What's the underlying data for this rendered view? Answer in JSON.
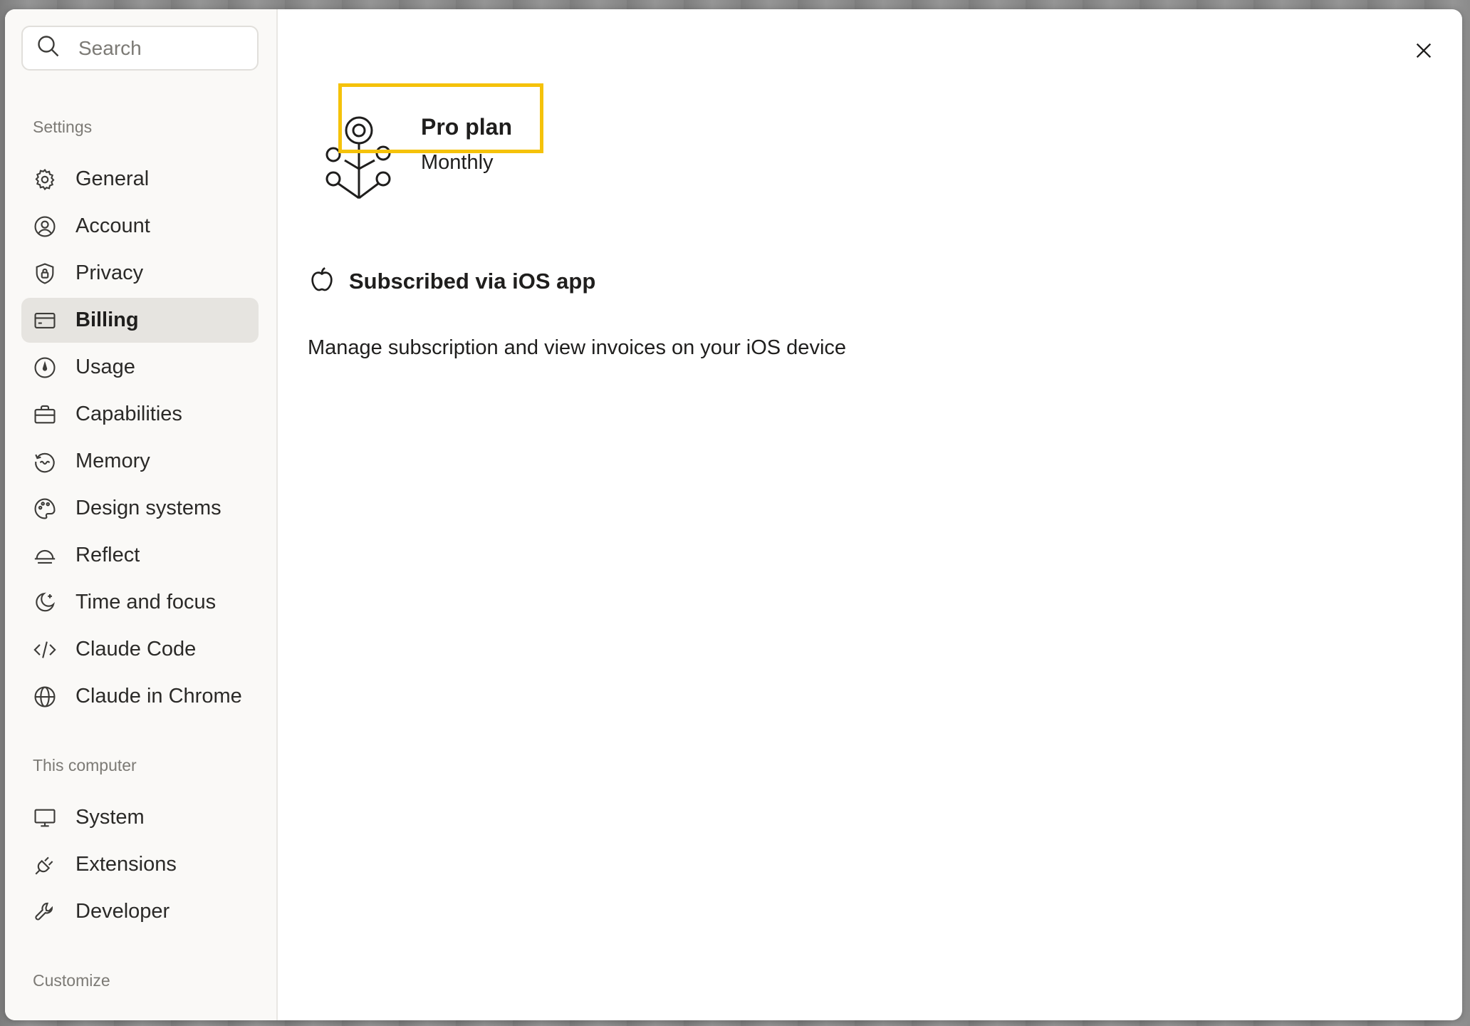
{
  "search": {
    "placeholder": "Search"
  },
  "sidebar": {
    "sections": [
      {
        "label": "Settings"
      },
      {
        "label": "This computer"
      },
      {
        "label": "Customize"
      }
    ],
    "settings_items": [
      {
        "label": "General",
        "icon": "gear-icon"
      },
      {
        "label": "Account",
        "icon": "user-circle-icon"
      },
      {
        "label": "Privacy",
        "icon": "shield-lock-icon"
      },
      {
        "label": "Billing",
        "icon": "credit-card-icon",
        "active": true
      },
      {
        "label": "Usage",
        "icon": "gauge-icon"
      },
      {
        "label": "Capabilities",
        "icon": "briefcase-icon"
      },
      {
        "label": "Memory",
        "icon": "memory-icon"
      },
      {
        "label": "Design systems",
        "icon": "palette-icon"
      },
      {
        "label": "Reflect",
        "icon": "reflect-icon"
      },
      {
        "label": "Time and focus",
        "icon": "moon-icon"
      },
      {
        "label": "Claude Code",
        "icon": "code-icon"
      },
      {
        "label": "Claude in Chrome",
        "icon": "globe-icon"
      }
    ],
    "computer_items": [
      {
        "label": "System",
        "icon": "monitor-icon"
      },
      {
        "label": "Extensions",
        "icon": "plug-icon"
      },
      {
        "label": "Developer",
        "icon": "wrench-icon"
      }
    ]
  },
  "billing": {
    "plan_name": "Pro plan",
    "plan_cycle": "Monthly",
    "subscribed_via": "Subscribed via iOS app",
    "manage_text": "Manage subscription and view invoices on your iOS device"
  },
  "colors": {
    "highlight": "#f5c20a",
    "active_item_bg": "#e6e4e0",
    "sidebar_bg": "#faf9f7"
  }
}
